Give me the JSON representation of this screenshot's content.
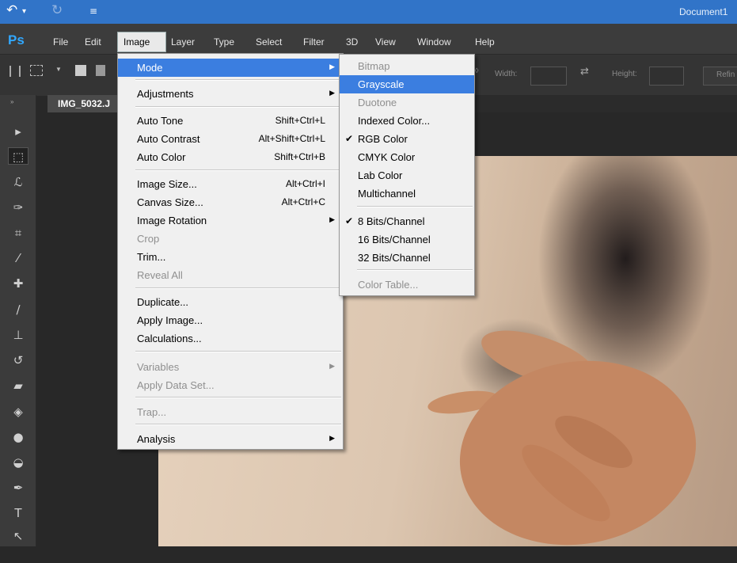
{
  "titlebar": {
    "document_title": "Document1",
    "undo_icon": "undo-icon",
    "redo_icon": "redo-icon",
    "customize_icon": "customize-icon"
  },
  "app_logo": "Ps",
  "menubar": [
    "File",
    "Edit",
    "Image",
    "Layer",
    "Type",
    "Select",
    "Filter",
    "3D",
    "View",
    "Window",
    "Help"
  ],
  "options": {
    "width_label": "Width:",
    "height_label": "Height:",
    "refine_label": "Refin"
  },
  "document_tab": "IMG_5032.J",
  "image_menu": {
    "mode": "Mode",
    "adjustments": "Adjustments",
    "auto_tone": "Auto Tone",
    "auto_tone_sc": "Shift+Ctrl+L",
    "auto_contrast": "Auto Contrast",
    "auto_contrast_sc": "Alt+Shift+Ctrl+L",
    "auto_color": "Auto Color",
    "auto_color_sc": "Shift+Ctrl+B",
    "image_size": "Image Size...",
    "image_size_sc": "Alt+Ctrl+I",
    "canvas_size": "Canvas Size...",
    "canvas_size_sc": "Alt+Ctrl+C",
    "image_rotation": "Image Rotation",
    "crop": "Crop",
    "trim": "Trim...",
    "reveal_all": "Reveal All",
    "duplicate": "Duplicate...",
    "apply_image": "Apply Image...",
    "calculations": "Calculations...",
    "variables": "Variables",
    "apply_data_set": "Apply Data Set...",
    "trap": "Trap...",
    "analysis": "Analysis"
  },
  "mode_menu": {
    "bitmap": "Bitmap",
    "grayscale": "Grayscale",
    "duotone": "Duotone",
    "indexed_color": "Indexed Color...",
    "rgb_color": "RGB Color",
    "cmyk_color": "CMYK Color",
    "lab_color": "Lab Color",
    "multichannel": "Multichannel",
    "bits8": "8 Bits/Channel",
    "bits16": "16 Bits/Channel",
    "bits32": "32 Bits/Channel",
    "color_table": "Color Table..."
  },
  "colors": {
    "highlight": "#3b7ee0",
    "titlebar": "#3174c8",
    "ps_blue": "#31a8ff"
  }
}
